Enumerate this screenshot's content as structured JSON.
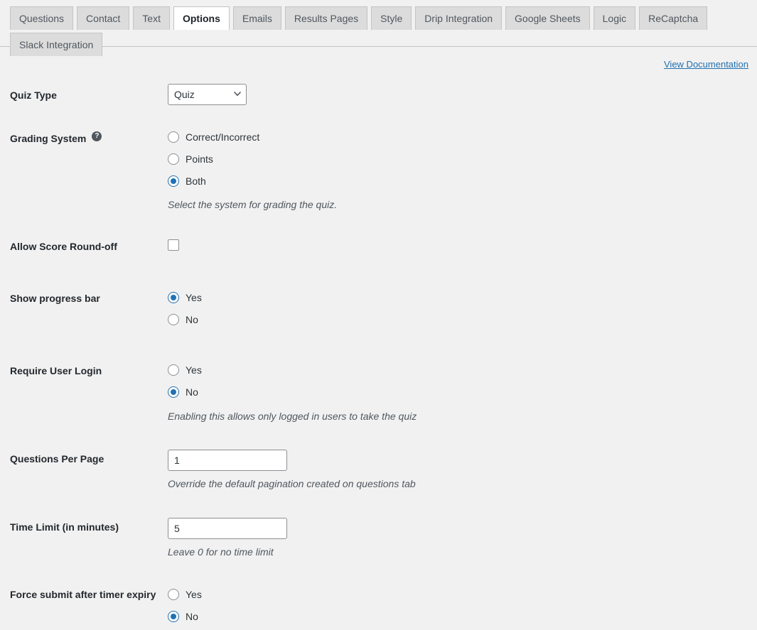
{
  "tabs": {
    "items": [
      {
        "label": "Questions",
        "active": false
      },
      {
        "label": "Contact",
        "active": false
      },
      {
        "label": "Text",
        "active": false
      },
      {
        "label": "Options",
        "active": true
      },
      {
        "label": "Emails",
        "active": false
      },
      {
        "label": "Results Pages",
        "active": false
      },
      {
        "label": "Style",
        "active": false
      },
      {
        "label": "Drip Integration",
        "active": false
      },
      {
        "label": "Google Sheets",
        "active": false
      },
      {
        "label": "Logic",
        "active": false
      },
      {
        "label": "ReCaptcha",
        "active": false
      },
      {
        "label": "Slack Integration",
        "active": false
      }
    ]
  },
  "documentation": {
    "link_label": "View Documentation"
  },
  "settings": {
    "quiz_type": {
      "label": "Quiz Type",
      "value": "Quiz",
      "options": [
        "Quiz"
      ]
    },
    "grading_system": {
      "label": "Grading System",
      "help_icon": "help-icon",
      "help_glyph": "?",
      "options": [
        {
          "label": "Correct/Incorrect",
          "checked": false
        },
        {
          "label": "Points",
          "checked": false
        },
        {
          "label": "Both",
          "checked": true
        }
      ],
      "description": "Select the system for grading the quiz."
    },
    "allow_score_roundoff": {
      "label": "Allow Score Round-off",
      "checked": false
    },
    "show_progress_bar": {
      "label": "Show progress bar",
      "options": [
        {
          "label": "Yes",
          "checked": true
        },
        {
          "label": "No",
          "checked": false
        }
      ]
    },
    "require_user_login": {
      "label": "Require User Login",
      "options": [
        {
          "label": "Yes",
          "checked": false
        },
        {
          "label": "No",
          "checked": true
        }
      ],
      "description": "Enabling this allows only logged in users to take the quiz"
    },
    "questions_per_page": {
      "label": "Questions Per Page",
      "value": "1",
      "placeholder": "",
      "description": "Override the default pagination created on questions tab"
    },
    "time_limit": {
      "label": "Time Limit (in minutes)",
      "value": "5",
      "placeholder": "",
      "description": "Leave 0 for no time limit"
    },
    "force_submit": {
      "label": "Force submit after timer expiry",
      "options": [
        {
          "label": "Yes",
          "checked": false
        },
        {
          "label": "No",
          "checked": true
        }
      ]
    }
  },
  "colors": {
    "accent": "#2271b1",
    "page_bg": "#f1f1f1",
    "tab_bg": "#dcdcdc",
    "border": "#c3c4c7",
    "label_text": "#23282d"
  }
}
